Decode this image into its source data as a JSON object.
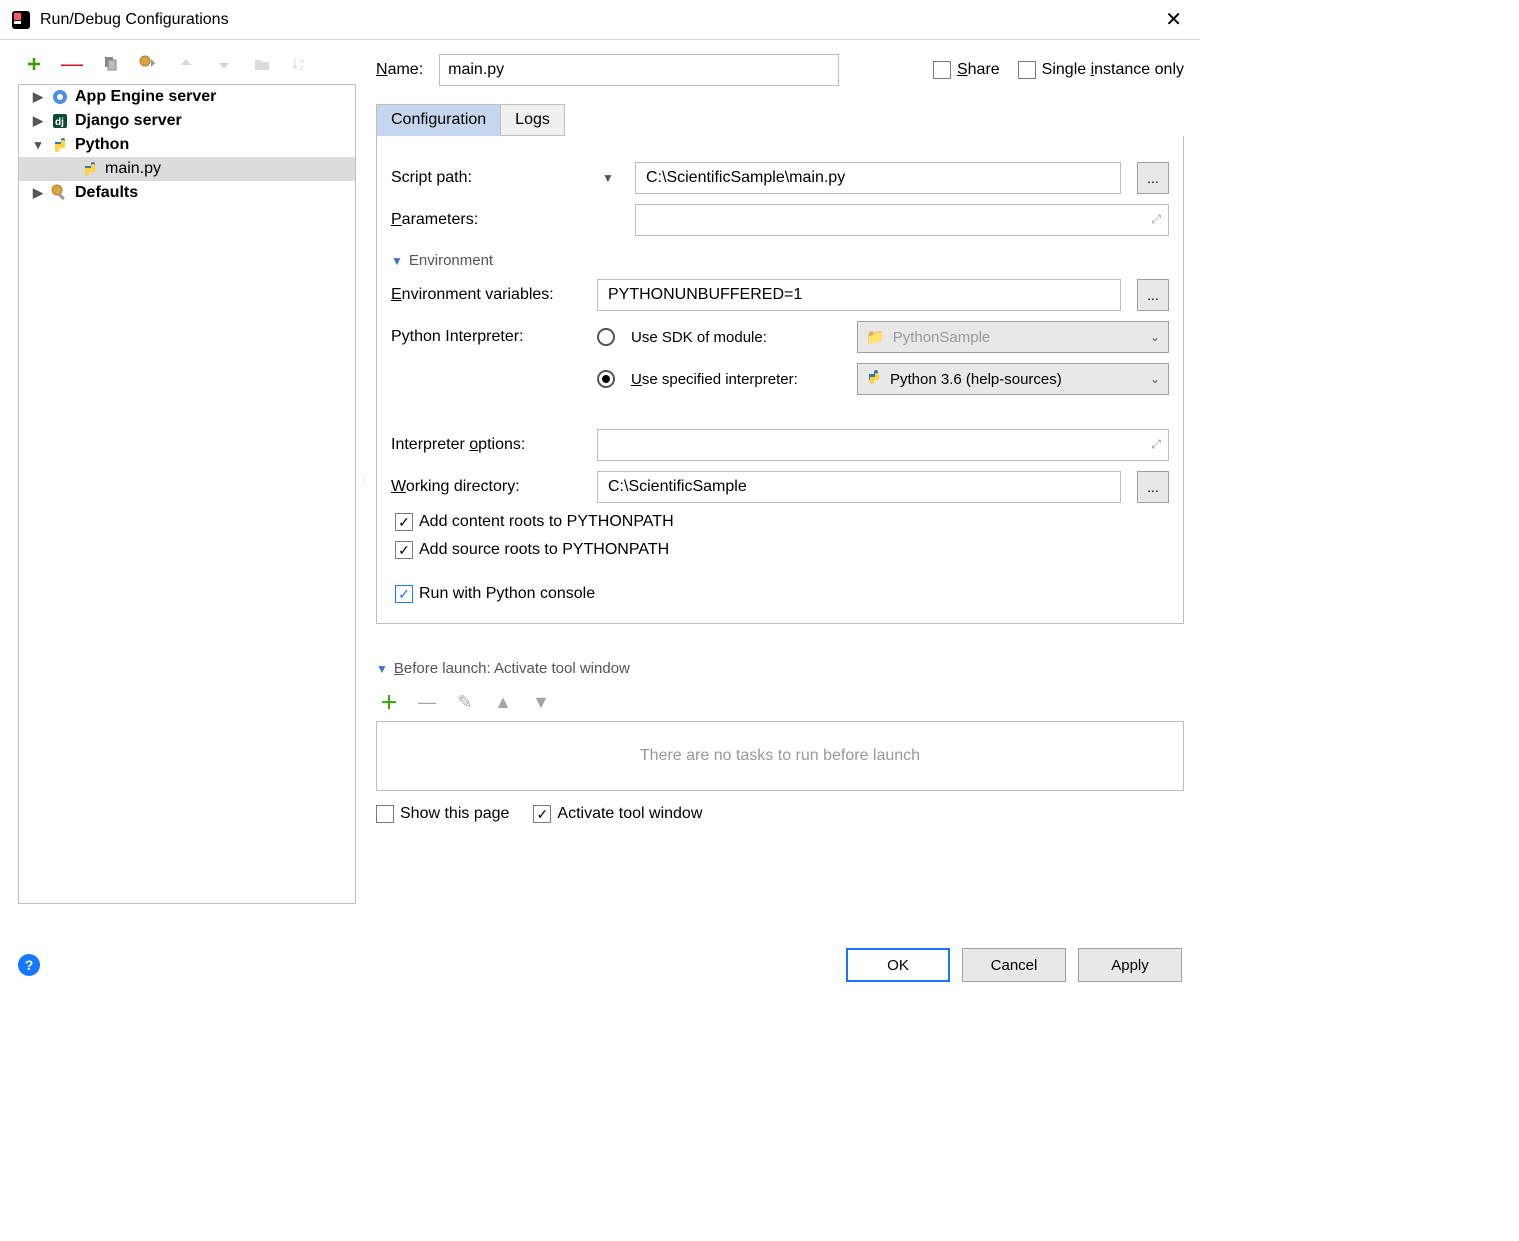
{
  "window": {
    "title": "Run/Debug Configurations"
  },
  "name_label": "Name:",
  "name_value": "main.py",
  "share_label": "Share",
  "single_instance_label": "Single instance only",
  "tree": {
    "app_engine": "App Engine server",
    "django": "Django server",
    "python": "Python",
    "main_py": "main.py",
    "defaults": "Defaults"
  },
  "tabs": {
    "configuration": "Configuration",
    "logs": "Logs"
  },
  "fields": {
    "script_path_label": "Script path:",
    "script_path_value": "C:\\ScientificSample\\main.py",
    "parameters_label": "Parameters:",
    "parameters_value": "",
    "environment_title": "Environment",
    "env_vars_label": "Environment variables:",
    "env_vars_value": "PYTHONUNBUFFERED=1",
    "interpreter_label": "Python Interpreter:",
    "use_sdk_label": "Use SDK of module:",
    "sdk_module": "PythonSample",
    "use_specified_label": "Use specified interpreter:",
    "specified_interp": "Python 3.6 (help-sources)",
    "interp_options_label": "Interpreter options:",
    "interp_options_value": "",
    "working_dir_label": "Working directory:",
    "working_dir_value": "C:\\ScientificSample",
    "add_content_roots": "Add content roots to PYTHONPATH",
    "add_source_roots": "Add source roots to PYTHONPATH",
    "run_with_console": "Run with Python console"
  },
  "before_launch": {
    "title": "Before launch: Activate tool window",
    "empty": "There are no tasks to run before launch",
    "show_this_page": "Show this page",
    "activate_tool_window": "Activate tool window"
  },
  "footer": {
    "ok": "OK",
    "cancel": "Cancel",
    "apply": "Apply"
  }
}
